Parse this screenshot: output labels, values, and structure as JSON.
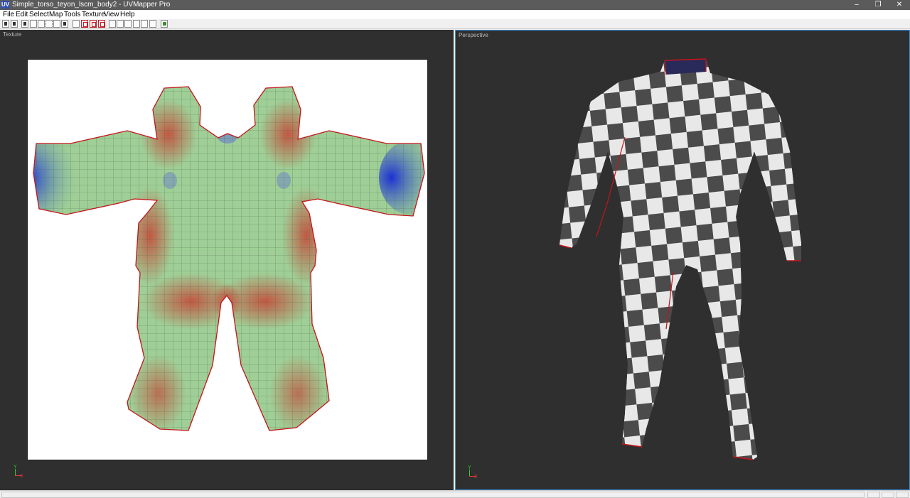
{
  "window": {
    "title": "Simple_torso_teyon_lscm_body2 - UVMapper Pro",
    "app_icon": "UV",
    "controls": {
      "minimize": "–",
      "restore": "❐",
      "close": "✕"
    }
  },
  "menu": {
    "items": [
      "File",
      "Edit",
      "Select",
      "Map",
      "Tools",
      "Texture",
      "View",
      "Help"
    ]
  },
  "toolbar": {
    "buttons": [
      "open-icon",
      "save-icon",
      "select-arrow-icon",
      "pan-hand-icon",
      "zoom-icon",
      "marquee-icon",
      "lasso-icon",
      "pointer-icon",
      "magic-wand-icon",
      "select-dashed-icon",
      "deselect-icon",
      "invert-select-icon",
      "clear-select-icon",
      "box-icon",
      "copy-icon",
      "paste-icon",
      "circle-icon",
      "sphere-icon",
      "grid-icon",
      "gear-icon"
    ]
  },
  "viewports": {
    "texture": {
      "label": "Texture",
      "axis_y": "Y",
      "axis_x": "X"
    },
    "perspective": {
      "label": "Perspective",
      "axis_y": "Y",
      "axis_x": "X"
    }
  },
  "colors": {
    "uv_fill": "#9fcf96",
    "stretch_red": "#c9604b",
    "compress_blue": "#2a3fd0",
    "seam": "#c4141a",
    "viewport_bg": "#2f2f2f",
    "active_border": "#3c8fd8",
    "checker_dark": "#4b4b4b",
    "checker_light": "#e8e8e8"
  }
}
